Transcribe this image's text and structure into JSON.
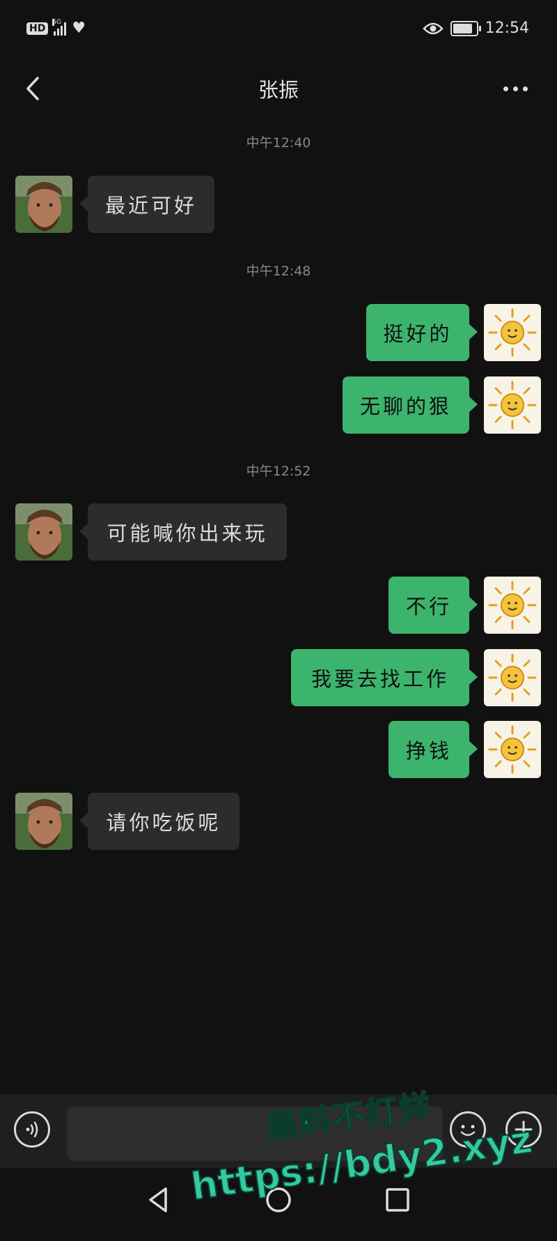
{
  "status_bar": {
    "network_badge": "HD",
    "signal_label": "5G",
    "time": "12:54",
    "battery_level": 0.85
  },
  "header": {
    "title": "张振",
    "back_icon": "chevron-left-icon",
    "more_icon": "more-horizontal-icon"
  },
  "timestamps": [
    "中午12:40",
    "中午12:48",
    "中午12:52"
  ],
  "messages": [
    {
      "from": "contact",
      "text": "最近可好"
    },
    {
      "from": "me",
      "text": "挺好的"
    },
    {
      "from": "me",
      "text": "无聊的狠"
    },
    {
      "from": "contact",
      "text": "可能喊你出来玩"
    },
    {
      "from": "me",
      "text": "不行"
    },
    {
      "from": "me",
      "text": "我要去找工作"
    },
    {
      "from": "me",
      "text": "挣钱"
    },
    {
      "from": "contact",
      "text": "请你吃饭呢"
    }
  ],
  "input_bar": {
    "voice_icon": "voice-icon",
    "input_value": "",
    "emoji_icon": "emoji-smile-icon",
    "plus_icon": "plus-icon"
  },
  "nav_bar": {
    "back_icon": "triangle-back-icon",
    "home_icon": "circle-home-icon",
    "recents_icon": "square-recents-icon"
  },
  "watermark": {
    "line1": "黑料不打烊",
    "line2": "https://bdy2.xyz"
  },
  "colors": {
    "background": "#111111",
    "sent_bubble": "#3db46d",
    "received_bubble": "#2c2c2c",
    "watermark": "#34c9a0"
  }
}
